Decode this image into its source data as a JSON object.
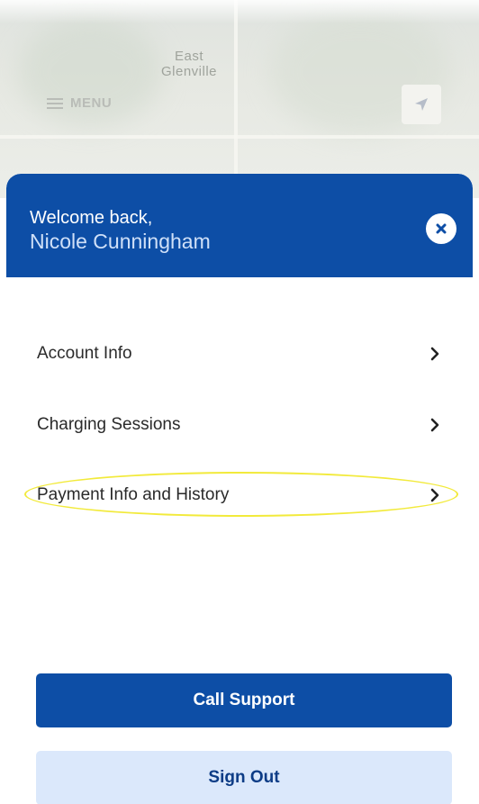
{
  "map": {
    "place_label": "East\nGlenville",
    "menu_label": "MENU",
    "icons": {
      "menu": "hamburger-icon",
      "locate": "location-arrow-icon"
    }
  },
  "sheet": {
    "welcome": "Welcome back,",
    "user_name": "Nicole Cunningham",
    "close_icon": "close-icon",
    "menu_items": [
      {
        "label": "Account Info",
        "icon": "chevron-right-icon"
      },
      {
        "label": "Charging Sessions",
        "icon": "chevron-right-icon"
      },
      {
        "label": "Payment Info and History",
        "icon": "chevron-right-icon",
        "highlighted": true
      }
    ],
    "primary_button": "Call Support",
    "secondary_button": "Sign Out"
  },
  "colors": {
    "brand_blue": "#0d4ea6",
    "light_blue": "#dbe8fb",
    "highlight_yellow": "#f2ea3b"
  }
}
